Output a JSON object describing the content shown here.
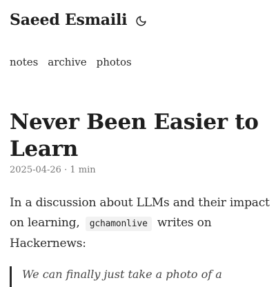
{
  "header": {
    "site_title": "Saeed Esmaili",
    "theme_toggle_icon": "moon-icon"
  },
  "nav": {
    "items": [
      {
        "label": "notes"
      },
      {
        "label": "archive"
      },
      {
        "label": "photos"
      }
    ]
  },
  "post": {
    "title": "Never Been Easier to Learn",
    "meta": "2025-04-26 · 1 min",
    "body_prefix": "In a discussion about LLMs and their impact on learning,",
    "username": "gchamonlive",
    "body_suffix": "writes on Hackernews:",
    "quote_text": "We can finally just take a photo of a"
  },
  "colors": {
    "text": "#1f1f1f",
    "meta": "#777777",
    "code_bg": "#f2f2f2",
    "quote_bar": "#2a2a2a"
  }
}
